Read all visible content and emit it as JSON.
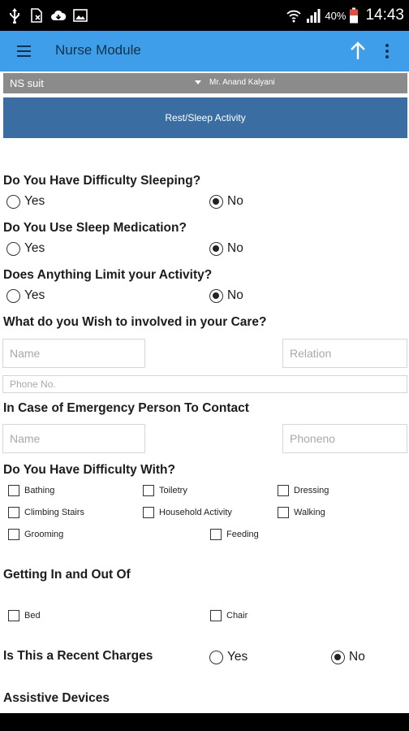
{
  "status_bar": {
    "icons": [
      "usb-icon",
      "sim-off-icon",
      "cloud-icon",
      "image-icon",
      "wifi-icon",
      "signal-icon",
      "battery-icon"
    ],
    "battery": "40%",
    "time": "14:43"
  },
  "app_bar": {
    "title": "Nurse Module",
    "background": "#3e9ee9"
  },
  "selector": {
    "left_value": "NS suit",
    "right_value": "Mr. Anand Kalyani"
  },
  "section_button": "Rest/Sleep Activity",
  "questions": {
    "difficulty_sleeping": {
      "label": "Do You Have Difficulty Sleeping?",
      "yes": "Yes",
      "no": "No",
      "selected": "No"
    },
    "sleep_medication": {
      "label": "Do You Use Sleep Medication?",
      "yes": "Yes",
      "no": "No",
      "selected": "No"
    },
    "limit_activity": {
      "label": "Does Anything Limit your Activity?",
      "yes": "Yes",
      "no": "No",
      "selected": "No"
    }
  },
  "care_involvement": {
    "label": "What do you Wish to involved in your Care?",
    "name_placeholder": "Name",
    "relation_placeholder": "Relation",
    "phone_placeholder": "Phone No."
  },
  "emergency_contact": {
    "label": "In Case of Emergency Person To Contact",
    "name_placeholder": "Name",
    "phone_placeholder": "Phoneno"
  },
  "difficulty_with": {
    "label": "Do You Have Difficulty With?",
    "options": [
      "Bathing",
      "Toiletry",
      "Dressing",
      "Climbing Stairs",
      "Household Activity",
      "Walking",
      "Grooming",
      "Feeding"
    ]
  },
  "getting_in_out": {
    "label": "Getting In and Out Of",
    "options": [
      "Bed",
      "Chair"
    ]
  },
  "recent_changes": {
    "label": "Is This a Recent Charges",
    "yes": "Yes",
    "no": "No",
    "selected": "No"
  },
  "assistive_devices": {
    "label": "Assistive Devices"
  }
}
